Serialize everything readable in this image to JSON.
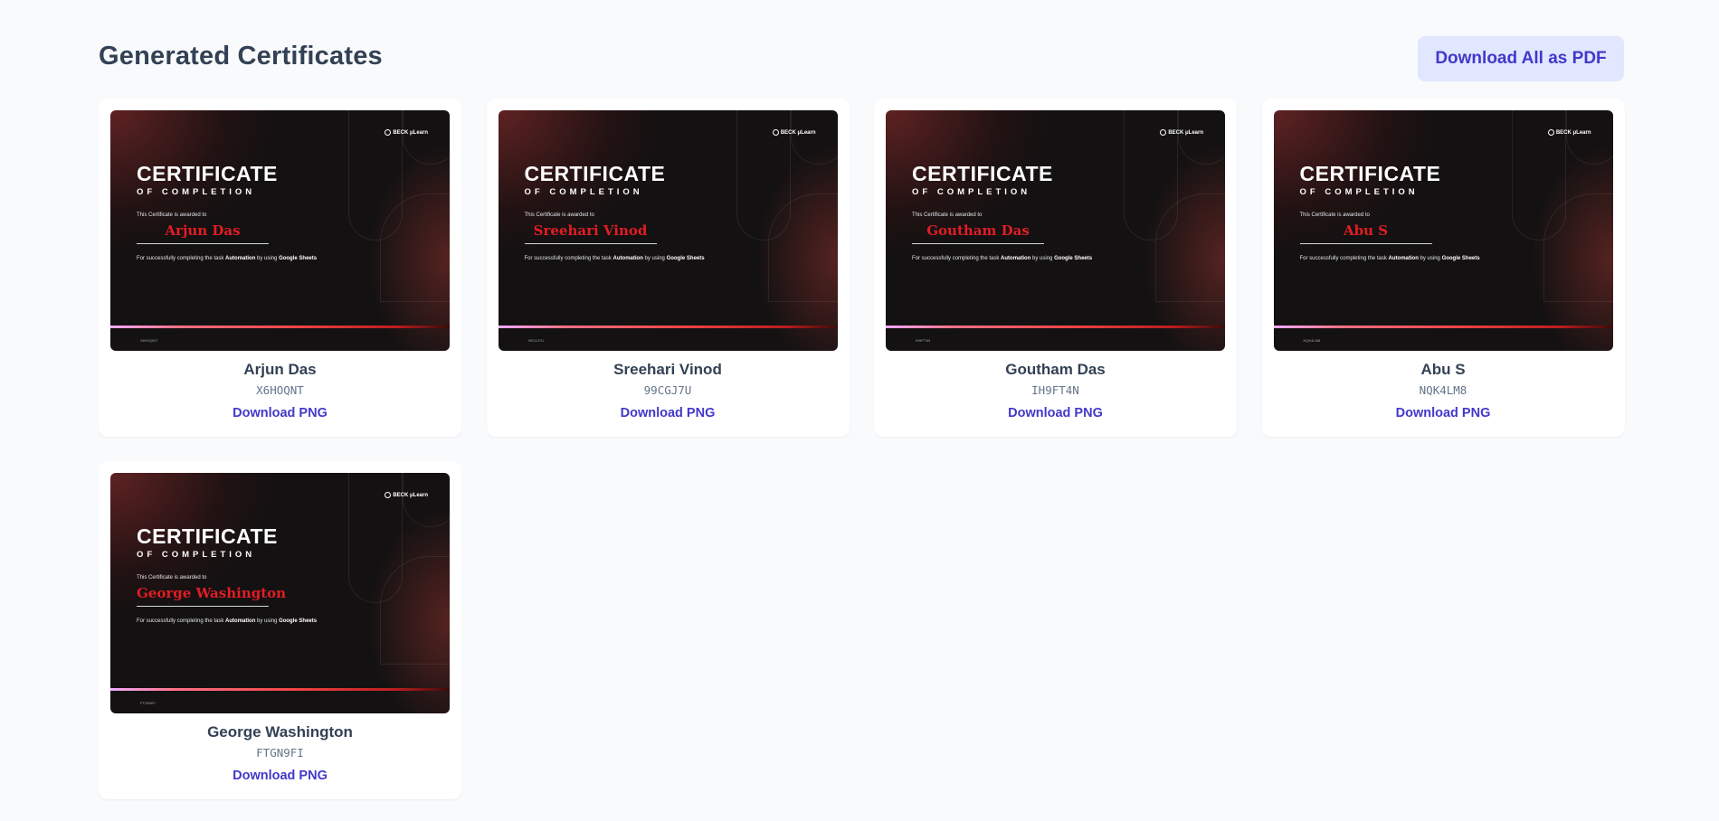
{
  "header": {
    "title": "Generated Certificates",
    "download_all_label": "Download All as PDF"
  },
  "certificate_template": {
    "logo_text": "BECK μLearn",
    "heading": "CERTIFICATE",
    "subheading": "OF COMPLETION",
    "awarded_text": "This Certificate is awarded to",
    "body_prefix": "For successfully completing the task ",
    "body_task": "Automation",
    "body_middle": " by using ",
    "body_tool": "Google Sheets"
  },
  "certificates": [
    {
      "name": "Arjun Das",
      "code": "X6HOQNT",
      "download_label": "Download PNG"
    },
    {
      "name": "Sreehari Vinod",
      "code": "99CGJ7U",
      "download_label": "Download PNG"
    },
    {
      "name": "Goutham Das",
      "code": "IH9FT4N",
      "download_label": "Download PNG"
    },
    {
      "name": "Abu S",
      "code": "NQK4LM8",
      "download_label": "Download PNG"
    },
    {
      "name": "George Washington",
      "code": "FTGN9FI",
      "download_label": "Download PNG"
    }
  ],
  "colors": {
    "background": "#f8fafc",
    "accent": "#4338ca",
    "accent_bg": "#e0e7ff",
    "certificate_name": "#e11d24"
  }
}
